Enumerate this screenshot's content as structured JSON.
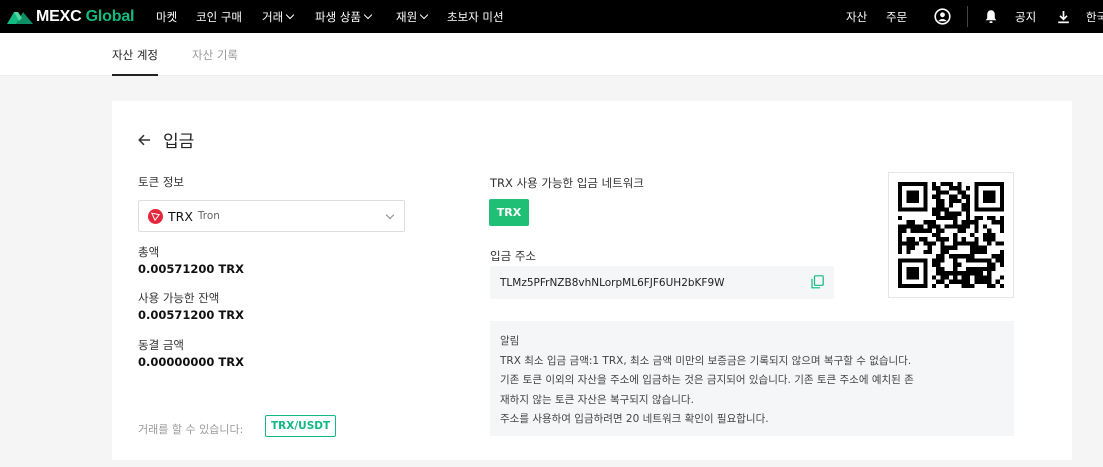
{
  "brand": {
    "name_part1": "MEXC",
    "name_part2": " Global",
    "accent": "#12b981"
  },
  "nav": {
    "market": "마켓",
    "buy_crypto": "코인 구매",
    "trade": "거래",
    "derivatives": "파생 상품",
    "finance": "재원",
    "beginner": "초보자 미션",
    "assets": "자산",
    "orders": "주문",
    "notice": "공지",
    "language": "한국"
  },
  "tabs": {
    "account": "자산 계정",
    "history": "자산 기록"
  },
  "deposit": {
    "title": "입금",
    "token_info_label": "토큰 정보",
    "token": {
      "symbol": "TRX",
      "name": "Tron"
    },
    "total_label": "총액",
    "total_value": "0.00571200 TRX",
    "available_label": "사용 가능한 잔액",
    "available_value": "0.00571200 TRX",
    "frozen_label": "동결 금액",
    "frozen_value": "0.00000000 TRX",
    "tradable_label": "거래를 할 수 있습니다:",
    "trading_pair": "TRX/USDT",
    "network_label": "TRX 사용 가능한 입금 네트워크",
    "network": "TRX",
    "address_label": "입금 주소",
    "address": "TLMz5PFrNZB8vhNLorpML6FJF6UH2bKF9W"
  },
  "notice": {
    "title": "알림",
    "line1": "TRX 최소 입금 금액:1 TRX, 최소 금액 미만의 보증금은 기록되지 않으며 복구할 수 없습니다.",
    "line2": "기존 토큰 이외의 자산을 주소에 입금하는 것은 금지되어 있습니다. 기존 토큰 주소에 예치된 존",
    "line3": "재하지 않는 토큰 자산은 복구되지 않습니다.",
    "line4": "주소를 사용하여 입금하려면 20 네트워크 확인이 필요합니다."
  }
}
